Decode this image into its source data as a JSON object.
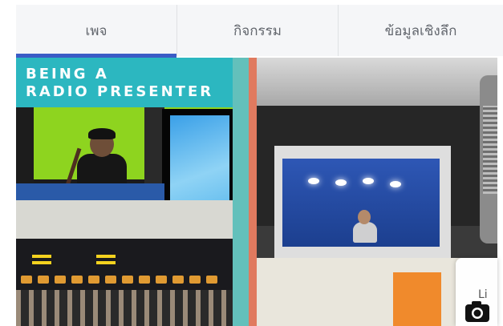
{
  "tabs": [
    {
      "label": "เพจ"
    },
    {
      "label": "กิจกรรม"
    },
    {
      "label": "ข้อมูลเชิงลึก"
    }
  ],
  "active_tab_index": 0,
  "colors": {
    "tab_bg": "#f5f6f8",
    "tab_text": "#62666d",
    "active_underline": "#3b5cc6",
    "banner_teal": "#2cb7c0",
    "divider_teal": "#63c0bb",
    "divider_coral": "#e07a5f"
  },
  "photos": [
    {
      "banner_lines": [
        "BEING A",
        "RADIO PRESENTER"
      ]
    },
    {}
  ],
  "camera_widget": {
    "text_fragment": "Li",
    "icon": "camera-icon"
  }
}
